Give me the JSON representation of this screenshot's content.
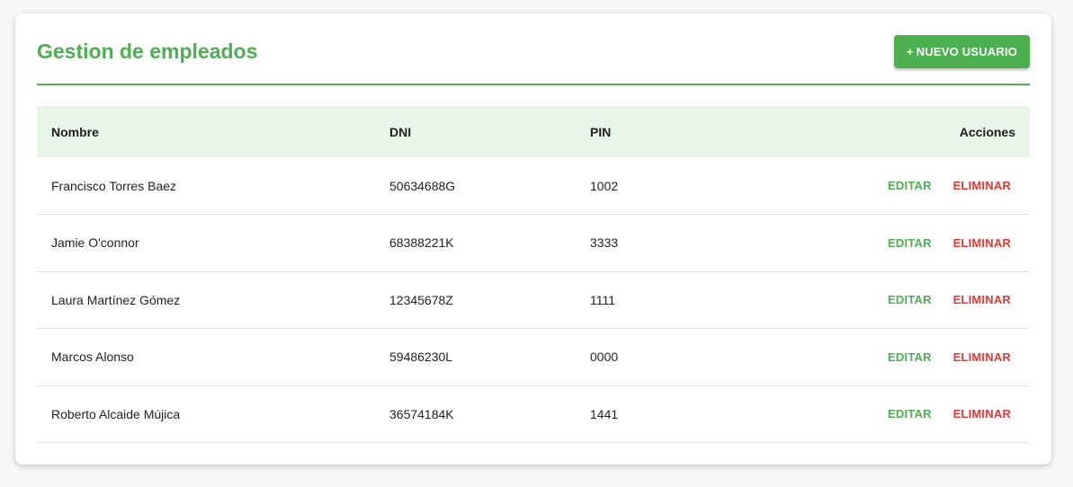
{
  "header": {
    "title": "Gestion de empleados",
    "new_user_icon": "+",
    "new_user_label": "NUEVO USUARIO"
  },
  "table": {
    "columns": [
      "Nombre",
      "DNI",
      "PIN",
      "Acciones"
    ],
    "rows": [
      {
        "nombre": "Francisco Torres Baez",
        "dni": "50634688G",
        "pin": "1002"
      },
      {
        "nombre": "Jamie O'connor",
        "dni": "68388221K",
        "pin": "3333"
      },
      {
        "nombre": "Laura Martínez Gómez",
        "dni": "12345678Z",
        "pin": "1111"
      },
      {
        "nombre": "Marcos Alonso",
        "dni": "59486230L",
        "pin": "0000"
      },
      {
        "nombre": "Roberto Alcaide Mújica",
        "dni": "36574184K",
        "pin": "1441"
      }
    ],
    "edit_label": "EDITAR",
    "delete_label": "ELIMINAR"
  },
  "colors": {
    "accent": "#4caf50",
    "danger": "#e53935",
    "header_bg": "#e8f5e9"
  }
}
